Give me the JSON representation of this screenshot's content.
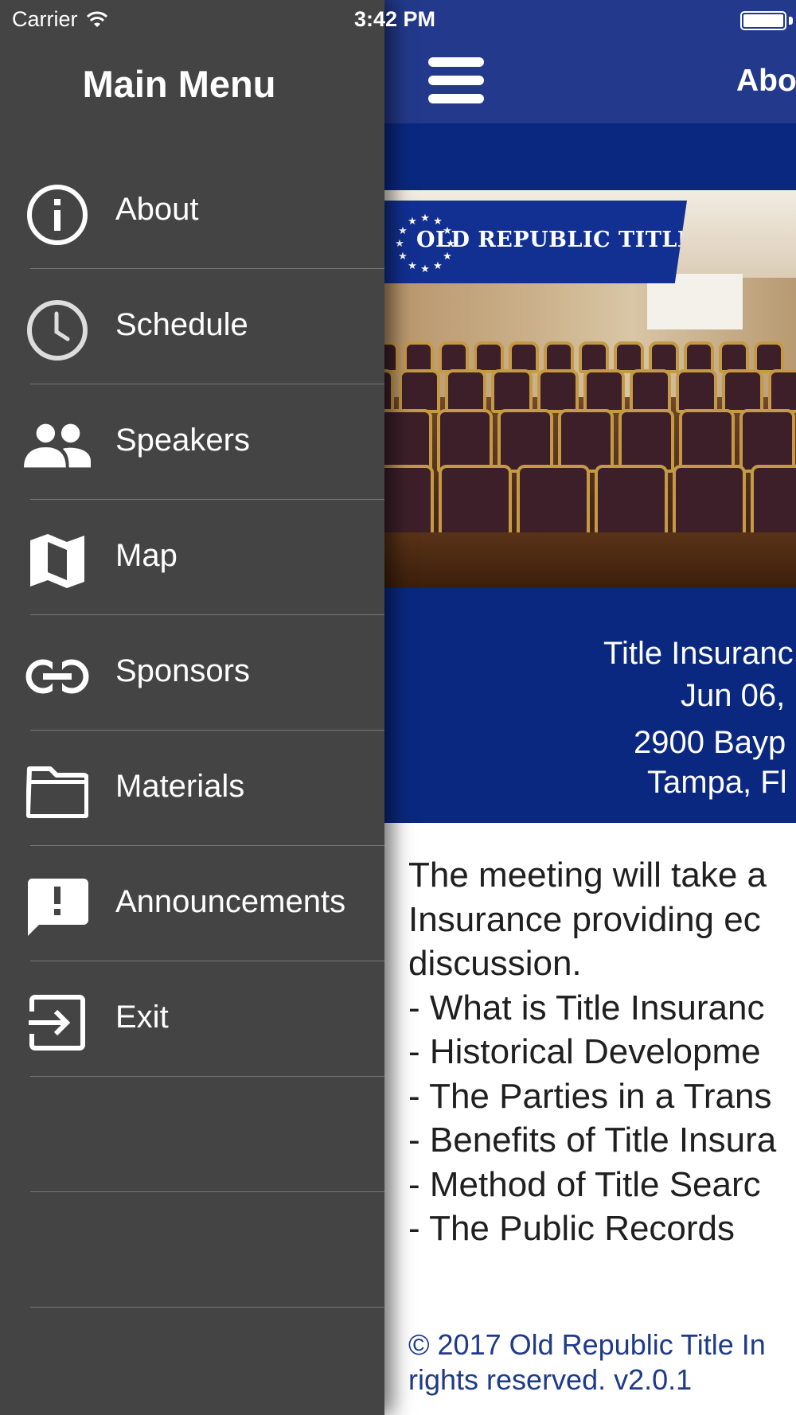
{
  "status_bar": {
    "carrier": "Carrier",
    "time": "3:42 PM"
  },
  "drawer": {
    "title": "Main Menu",
    "items": [
      {
        "label": "About",
        "icon": "info-icon"
      },
      {
        "label": "Schedule",
        "icon": "clock-icon"
      },
      {
        "label": "Speakers",
        "icon": "people-icon"
      },
      {
        "label": "Map",
        "icon": "map-icon"
      },
      {
        "label": "Sponsors",
        "icon": "link-icon"
      },
      {
        "label": "Materials",
        "icon": "folder-icon"
      },
      {
        "label": "Announcements",
        "icon": "announcement-icon"
      },
      {
        "label": "Exit",
        "icon": "exit-icon"
      }
    ]
  },
  "main": {
    "nav_title": "Abo",
    "logo_text": "OLD REPUBLIC TITLE",
    "event": {
      "title": "Title Insuranc",
      "date": "Jun 06,",
      "address_line1": "2900 Bayp",
      "address_line2": "Tampa, Fl"
    },
    "description_lines": [
      "The meeting will take a",
      "Insurance providing ec",
      "discussion.",
      "- What is Title Insuranc",
      "- Historical Developme",
      "- The Parties in a Trans",
      "- Benefits of Title Insura",
      "- Method of Title Searc",
      "- The Public Records"
    ],
    "footer_line1": "© 2017 Old Republic Title In",
    "footer_line2": "rights reserved. v2.0.1"
  },
  "colors": {
    "drawer_bg": "#444444",
    "nav_bar": "#233a8c",
    "event_panel": "#0a2880",
    "footer_text": "#1e3a8a"
  }
}
